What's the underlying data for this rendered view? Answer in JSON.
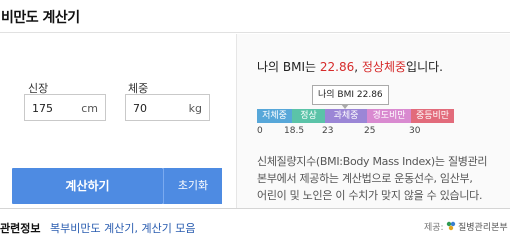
{
  "header": {
    "title": "비만도 계산기"
  },
  "form": {
    "height_label": "신장",
    "height_value": "175",
    "height_unit": "cm",
    "weight_label": "체중",
    "weight_value": "70",
    "weight_unit": "kg",
    "calc_button": "계산하기",
    "reset_button": "초기화"
  },
  "result": {
    "prefix": "나의 BMI는 ",
    "bmi": "22.86",
    "comma": ", ",
    "status": "정상체중",
    "suffix": "입니다."
  },
  "tooltip": {
    "text": "나의 BMI 22.86"
  },
  "scale": {
    "bmi_value": 22.86,
    "segments": [
      {
        "label": "저체중",
        "color": "#57a7d9"
      },
      {
        "label": "정상",
        "color": "#5bc3a8"
      },
      {
        "label": "과체중",
        "color": "#9b86d6"
      },
      {
        "label": "경도비만",
        "color": "#d98ad0"
      },
      {
        "label": "중등비만",
        "color": "#e26b7b"
      }
    ],
    "ticks": [
      "0",
      "18.5",
      "23",
      "25",
      "30"
    ]
  },
  "description": {
    "line1": "신체질량지수(BMI:Body Mass Index)는 질병관리",
    "line2": "본부에서 제공하는 계산법으로 운동선수, 임산부,",
    "line3": "어린이 및 노인은 이 수치가 맞지 않을 수 있습니다."
  },
  "footer": {
    "related_label": "관련정보",
    "related_links": "복부비만도 계산기, 계산기 모음",
    "source_label": "제공:",
    "source_name": "질병관리본부"
  }
}
